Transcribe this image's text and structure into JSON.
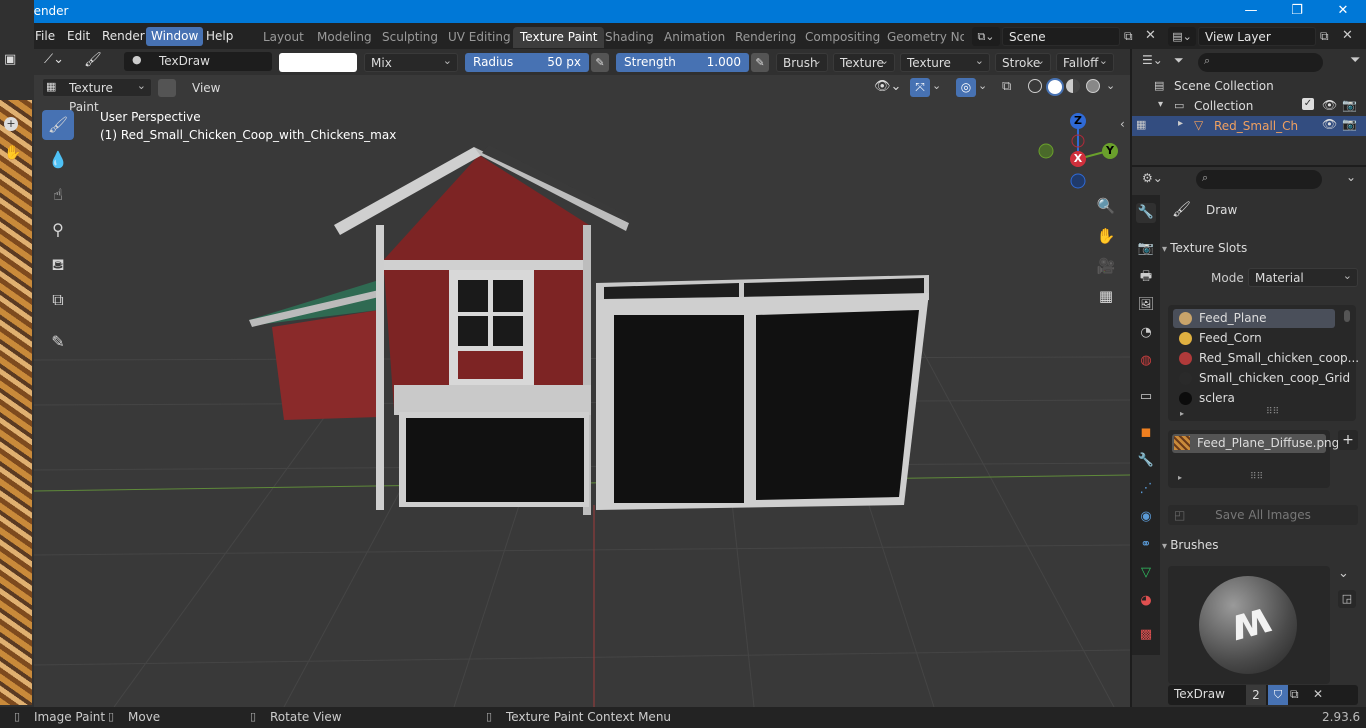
{
  "window": {
    "title": "Blender"
  },
  "menu": {
    "items": [
      "File",
      "Edit",
      "Render",
      "Window",
      "Help"
    ],
    "active_index": 3
  },
  "workspaces": {
    "tabs": [
      "Layout",
      "Modeling",
      "Sculpting",
      "UV Editing",
      "Texture Paint",
      "Shading",
      "Animation",
      "Rendering",
      "Compositing",
      "Geometry Nod"
    ],
    "active_index": 4
  },
  "scene": {
    "name": "Scene",
    "view_layer": "View Layer"
  },
  "tool_header": {
    "brush_name": "TexDraw",
    "blend_mode": "Mix",
    "radius_label": "Radius",
    "radius_value": "50 px",
    "strength_label": "Strength",
    "strength_value": "1.000",
    "dropdowns": [
      "Brush",
      "Texture",
      "Texture Mask",
      "Stroke",
      "Falloff"
    ]
  },
  "viewport_header": {
    "mode": "Texture Paint",
    "view": "View"
  },
  "viewport": {
    "perspective": "User Perspective",
    "object": "(1) Red_Small_Chicken_Coop_with_Chickens_max",
    "gizmo": {
      "z": "Z",
      "x": "X",
      "y": "Y"
    }
  },
  "outliner": {
    "scene_collection": "Scene Collection",
    "collection": "Collection",
    "object": "Red_Small_Chick"
  },
  "properties": {
    "tool_name": "Draw",
    "texture_slots_title": "Texture Slots",
    "mode_label": "Mode",
    "mode_value": "Material",
    "slots": [
      {
        "name": "Feed_Plane",
        "color": "#c9a46a",
        "selected": true
      },
      {
        "name": "Feed_Corn",
        "color": "#e0b040",
        "selected": false
      },
      {
        "name": "Red_Small_chicken_coop...",
        "color": "#b03a3a",
        "selected": false
      },
      {
        "name": "Small_chicken_coop_Grid",
        "color": "#2a2a2a",
        "selected": false
      },
      {
        "name": "sclera",
        "color": "#0c0c0c",
        "selected": false
      }
    ],
    "image_name": "Feed_Plane_Diffuse.png",
    "save_all": "Save All Images",
    "brushes_title": "Brushes",
    "brush_name": "TexDraw",
    "brush_users": "2"
  },
  "statusbar": {
    "image_paint": "Image Paint",
    "move": "Move",
    "rotate": "Rotate View",
    "context": "Texture Paint Context Menu",
    "version": "2.93.6"
  },
  "colors": {
    "accent": "#4772b3",
    "titlebar": "#0078d7",
    "viewport_bg": "#393939"
  }
}
